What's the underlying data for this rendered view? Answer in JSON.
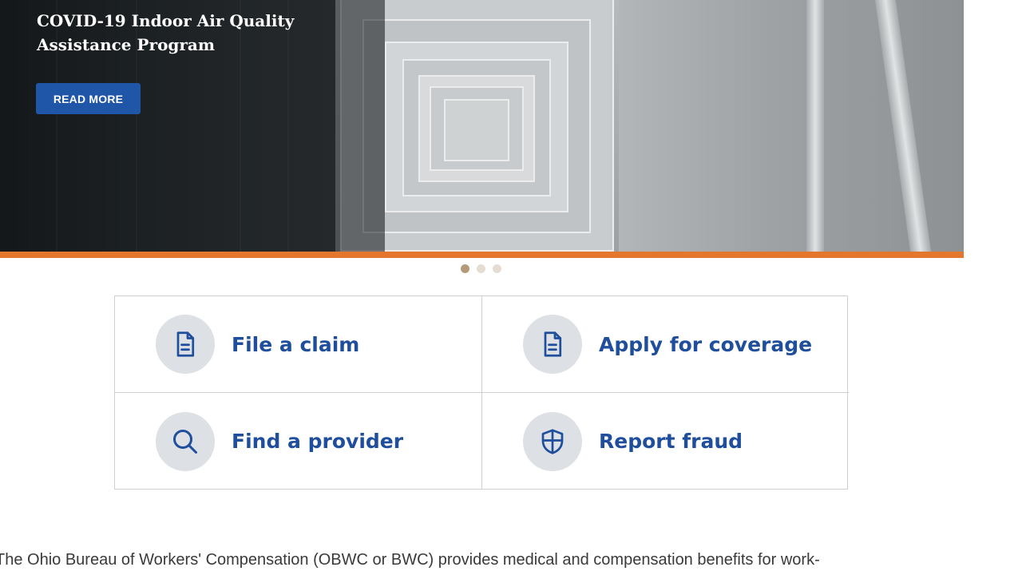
{
  "hero": {
    "title": "COVID-19 Indoor Air Quality Assistance Program",
    "button_label": "READ MORE",
    "accent_color": "#e4762e",
    "button_color": "#1f56a8"
  },
  "carousel": {
    "slide_count": 3,
    "active_index": 0
  },
  "quick_links": [
    {
      "label": "File a claim",
      "icon": "document-icon"
    },
    {
      "label": "Apply for coverage",
      "icon": "document-icon"
    },
    {
      "label": "Find a provider",
      "icon": "search-icon"
    },
    {
      "label": "Report fraud",
      "icon": "shield-icon"
    }
  ],
  "intro_text": "The Ohio Bureau of Workers' Compensation (OBWC or BWC) provides medical and compensation benefits for work-",
  "colors": {
    "link_blue": "#1f4e9c",
    "icon_circle": "#dde0e4"
  }
}
